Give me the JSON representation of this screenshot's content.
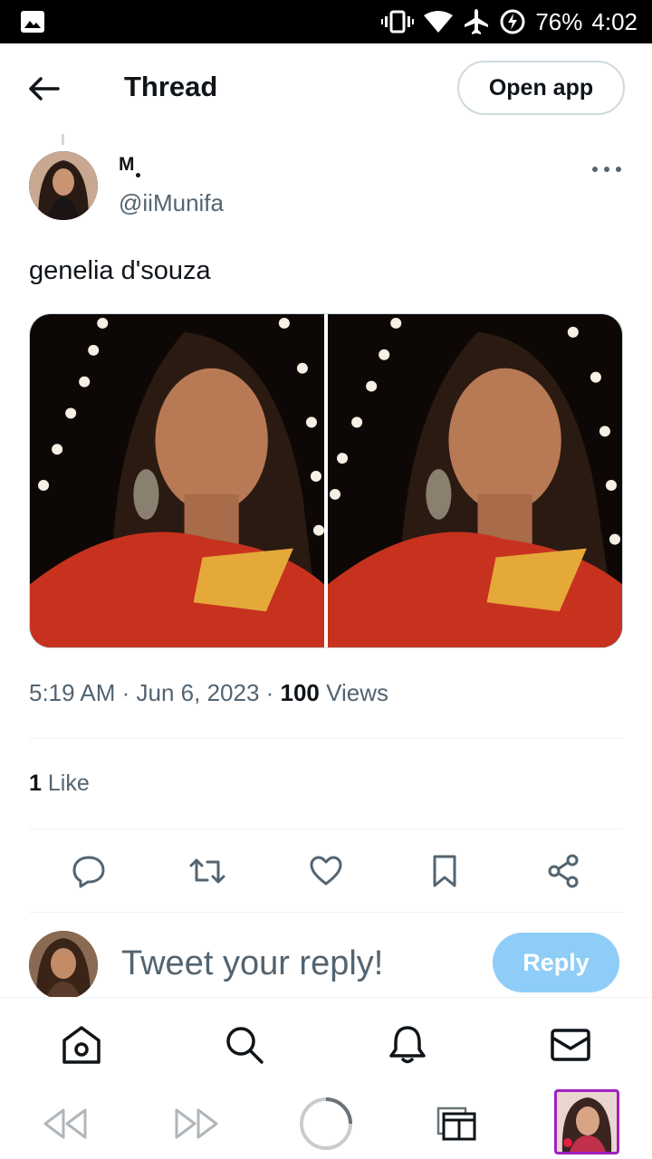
{
  "status_bar": {
    "battery": "76%",
    "time": "4:02",
    "icons": [
      "image-icon",
      "vibrate-icon",
      "wifi-icon",
      "airplane-icon",
      "battery-saver-icon"
    ]
  },
  "header": {
    "title": "Thread",
    "open_app": "Open app",
    "back_icon": "back-arrow-icon"
  },
  "tweet": {
    "display_name": "M",
    "handle": "@iiMunifa",
    "text": "genelia d'souza",
    "time": "5:19 AM",
    "date": "Jun 6, 2023",
    "views_count": "100",
    "views_label": "Views",
    "likes_count": "1",
    "likes_label": "Like",
    "media_count": 2
  },
  "actions": [
    "reply-icon",
    "retweet-icon",
    "like-icon",
    "bookmark-icon",
    "share-icon"
  ],
  "reply": {
    "placeholder": "Tweet your reply!",
    "button": "Reply"
  },
  "bottom_nav": [
    "home-icon",
    "search-icon",
    "notifications-icon",
    "messages-icon"
  ],
  "browser_bar": [
    "rewind-icon",
    "fast-forward-icon",
    "loading-icon",
    "tabs-icon",
    "app-thumbnail"
  ],
  "colors": {
    "text_primary": "#0f1419",
    "text_secondary": "#536471",
    "reply_button": "#8ecdf8",
    "border": "#cfd9de"
  }
}
